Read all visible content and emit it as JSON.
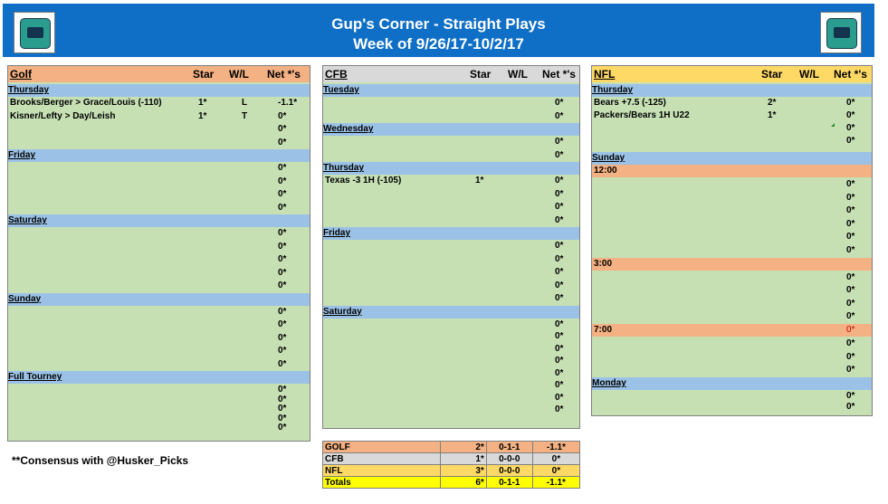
{
  "header": {
    "title_line1": "Gup's Corner - Straight Plays",
    "title_line2": "Week of 9/26/17-10/2/17",
    "background": "#0f6fc6",
    "logo_icon": "fish-logo-icon"
  },
  "columns": {
    "star": "Star",
    "wl": "W/L",
    "net": "Net *'s"
  },
  "golf": {
    "title": "Golf",
    "header_color": "#f4b183",
    "sections": [
      {
        "name": "Thursday",
        "rows": [
          {
            "pick": "Brooks/Berger > Grace/Louis (-110)",
            "star": "1*",
            "wl": "L",
            "net": "-1.1*"
          },
          {
            "pick": "Kisner/Lefty > Day/Leish",
            "star": "1*",
            "wl": "T",
            "net": "0*"
          },
          {
            "pick": "",
            "star": "",
            "wl": "",
            "net": "0*"
          },
          {
            "pick": "",
            "star": "",
            "wl": "",
            "net": "0*"
          }
        ]
      },
      {
        "name": "Friday",
        "rows": [
          {
            "pick": "",
            "star": "",
            "wl": "",
            "net": "0*"
          },
          {
            "pick": "",
            "star": "",
            "wl": "",
            "net": "0*"
          },
          {
            "pick": "",
            "star": "",
            "wl": "",
            "net": "0*"
          },
          {
            "pick": "",
            "star": "",
            "wl": "",
            "net": "0*"
          }
        ]
      },
      {
        "name": "Saturday",
        "rows": [
          {
            "pick": "",
            "star": "",
            "wl": "",
            "net": "0*"
          },
          {
            "pick": "",
            "star": "",
            "wl": "",
            "net": "0*"
          },
          {
            "pick": "",
            "star": "",
            "wl": "",
            "net": "0*"
          },
          {
            "pick": "",
            "star": "",
            "wl": "",
            "net": "0*"
          },
          {
            "pick": "",
            "star": "",
            "wl": "",
            "net": "0*"
          }
        ]
      },
      {
        "name": "Sunday",
        "rows": [
          {
            "pick": "",
            "star": "",
            "wl": "",
            "net": "0*"
          },
          {
            "pick": "",
            "star": "",
            "wl": "",
            "net": "0*"
          },
          {
            "pick": "",
            "star": "",
            "wl": "",
            "net": "0*"
          },
          {
            "pick": "",
            "star": "",
            "wl": "",
            "net": "0*"
          },
          {
            "pick": "",
            "star": "",
            "wl": "",
            "net": "0*"
          }
        ]
      },
      {
        "name": "Full Tourney",
        "rows": [
          {
            "pick": "",
            "star": "",
            "wl": "",
            "net": "0*"
          },
          {
            "pick": "",
            "star": "",
            "wl": "",
            "net": "0*"
          },
          {
            "pick": "",
            "star": "",
            "wl": "",
            "net": "0*"
          },
          {
            "pick": "",
            "star": "",
            "wl": "",
            "net": "0*"
          },
          {
            "pick": "",
            "star": "",
            "wl": "",
            "net": "0*"
          }
        ]
      }
    ]
  },
  "cfb": {
    "title": "CFB",
    "header_color": "#d9d9d9",
    "sections": [
      {
        "name": "Tuesday",
        "rows": [
          {
            "pick": "",
            "star": "",
            "wl": "",
            "net": "0*"
          },
          {
            "pick": "",
            "star": "",
            "wl": "",
            "net": "0*"
          }
        ]
      },
      {
        "name": "Wednesday",
        "rows": [
          {
            "pick": "",
            "star": "",
            "wl": "",
            "net": "0*"
          },
          {
            "pick": "",
            "star": "",
            "wl": "",
            "net": "0*"
          }
        ]
      },
      {
        "name": "Thursday",
        "rows": [
          {
            "pick": "Texas -3 1H (-105)",
            "star": "1*",
            "wl": "",
            "net": "0*"
          },
          {
            "pick": "",
            "star": "",
            "wl": "",
            "net": "0*"
          },
          {
            "pick": "",
            "star": "",
            "wl": "",
            "net": "0*"
          },
          {
            "pick": "",
            "star": "",
            "wl": "",
            "net": "0*"
          }
        ]
      },
      {
        "name": "Friday",
        "rows": [
          {
            "pick": "",
            "star": "",
            "wl": "",
            "net": "0*"
          },
          {
            "pick": "",
            "star": "",
            "wl": "",
            "net": "0*"
          },
          {
            "pick": "",
            "star": "",
            "wl": "",
            "net": "0*"
          },
          {
            "pick": "",
            "star": "",
            "wl": "",
            "net": "0*"
          },
          {
            "pick": "",
            "star": "",
            "wl": "",
            "net": "0*"
          }
        ]
      },
      {
        "name": "Saturday",
        "rows": [
          {
            "pick": "",
            "star": "",
            "wl": "",
            "net": "0*"
          },
          {
            "pick": "",
            "star": "",
            "wl": "",
            "net": "0*"
          },
          {
            "pick": "",
            "star": "",
            "wl": "",
            "net": "0*"
          },
          {
            "pick": "",
            "star": "",
            "wl": "",
            "net": "0*"
          },
          {
            "pick": "",
            "star": "",
            "wl": "",
            "net": "0*"
          },
          {
            "pick": "",
            "star": "",
            "wl": "",
            "net": "0*"
          },
          {
            "pick": "",
            "star": "",
            "wl": "",
            "net": "0*"
          },
          {
            "pick": "",
            "star": "",
            "wl": "",
            "net": "0*"
          }
        ]
      }
    ]
  },
  "nfl": {
    "title": "NFL",
    "header_color": "#ffd966",
    "thursday": {
      "name": "Thursday",
      "rows": [
        {
          "pick": "Bears +7.5 (-125)",
          "star": "2*",
          "wl": "",
          "net": "0*"
        },
        {
          "pick": "Packers/Bears 1H U22",
          "star": "1*",
          "wl": "",
          "net": "0*"
        },
        {
          "pick": "",
          "star": "",
          "wl": "",
          "net": "0*"
        },
        {
          "pick": "",
          "star": "",
          "wl": "",
          "net": "0*"
        }
      ]
    },
    "sunday": {
      "name": "Sunday",
      "slots": [
        {
          "time": "12:00",
          "time_net": "",
          "rows": [
            "0*",
            "0*",
            "0*",
            "0*",
            "0*",
            "0*"
          ]
        },
        {
          "time": "3:00",
          "time_net": "",
          "rows": [
            "0*",
            "0*",
            "0*",
            "0*"
          ]
        },
        {
          "time": "7:00",
          "time_net": "0*",
          "rows": [
            "0*",
            "0*",
            "0*"
          ]
        }
      ]
    },
    "monday": {
      "name": "Monday",
      "rows": [
        "0*",
        "0*"
      ]
    }
  },
  "summary": [
    {
      "label": "GOLF",
      "stars": "2*",
      "record": "0-1-1",
      "net": "-1.1*",
      "color": "#f4b183"
    },
    {
      "label": "CFB",
      "stars": "1*",
      "record": "0-0-0",
      "net": "0*",
      "color": "#d9d9d9"
    },
    {
      "label": "NFL",
      "stars": "3*",
      "record": "0-0-0",
      "net": "0*",
      "color": "#ffd966"
    },
    {
      "label": "Totals",
      "stars": "6*",
      "record": "0-1-1",
      "net": "-1.1*",
      "color": "#ffff00"
    }
  ],
  "consensus_note": "**Consensus with @Husker_Picks"
}
